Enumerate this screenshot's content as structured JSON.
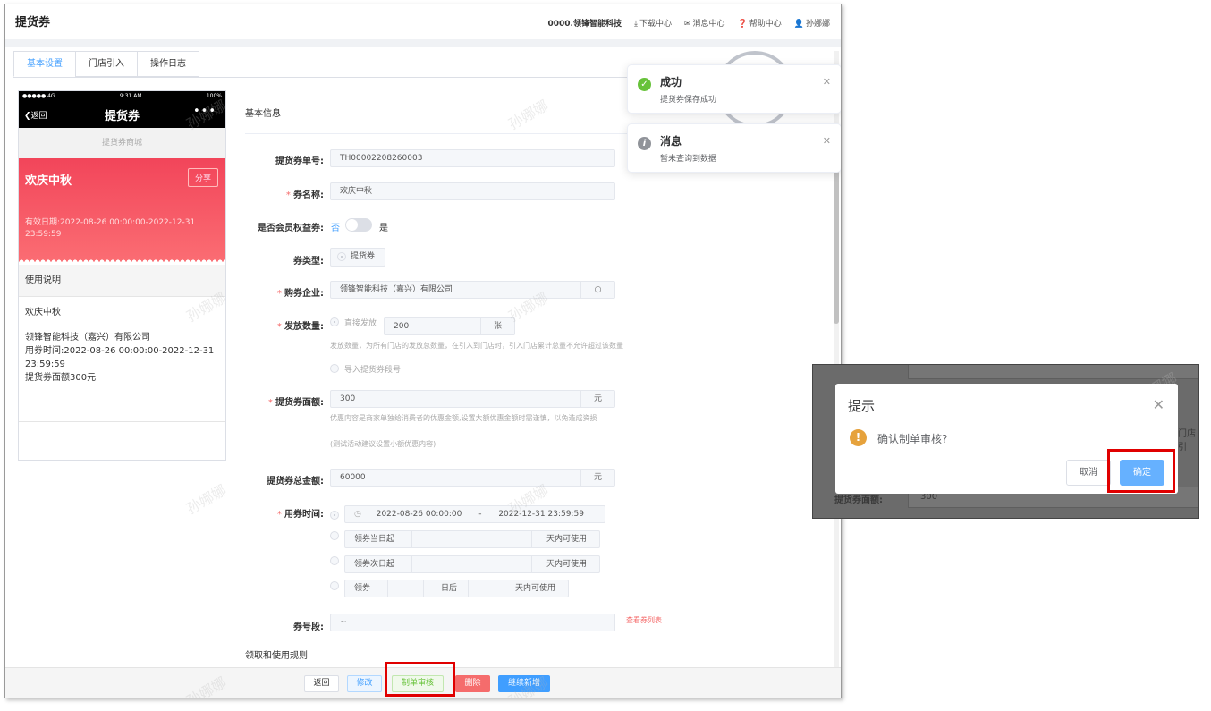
{
  "header": {
    "title": "提货券",
    "company": "0000.领锋智能科技",
    "links": [
      "下载中心",
      "消息中心",
      "帮助中心",
      "孙娜娜"
    ]
  },
  "tabs": [
    "基本设置",
    "门店引入",
    "操作日志"
  ],
  "phone": {
    "status_left": "●●●●● 4G",
    "status_time": "9:31 AM",
    "status_right": "100%",
    "back_label": "返回",
    "title": "提货券",
    "more": "•••",
    "mall_label": "提货券商城",
    "coupon_name": "欢庆中秋",
    "share_label": "分享",
    "validity": "有效日期:2022-08-26 00:00:00-2022-12-31 23:59:59",
    "usage_header": "使用说明",
    "usage_lines": [
      "欢庆中秋",
      "领锋智能科技（嘉兴）有限公司",
      "用券时间:2022-08-26 00:00:00-2022-12-31 23:59:59",
      "提货券面额300元"
    ]
  },
  "form": {
    "section_title": "基本信息",
    "fields": {
      "code_label": "提货券单号:",
      "code_value": "TH00002208260003",
      "name_label": "券名称:",
      "name_value": "欢庆中秋",
      "member_label": "是否会员权益券:",
      "member_off": "否",
      "member_on": "是",
      "type_label": "券类型:",
      "type_value": "提货券",
      "enterprise_label": "购券企业:",
      "enterprise_value": "领锋智能科技（嘉兴）有限公司",
      "qty_label": "发放数量:",
      "qty_option_direct": "直接发放",
      "qty_value": "200",
      "qty_unit": "张",
      "qty_hint": "发放数量，为所有门店的发放总数量，在引入到门店时，引入门店累计总量不允许超过该数量",
      "qty_option_import": "导入提货券段号",
      "face_label": "提货券面额:",
      "face_value": "300",
      "face_unit": "元",
      "face_hint": "优惠内容是商家单独给消费者的优惠金额,设置大额优惠金额时需谨慎，以免造成资损",
      "face_hint2": "(测试活动建议设置小额优惠内容)",
      "total_label": "提货券总金额:",
      "total_value": "60000",
      "total_unit": "元",
      "time_label": "用券时间:",
      "time_start": "2022-08-26 00:00:00",
      "time_sep": "-",
      "time_end": "2022-12-31 23:59:59",
      "rel1_prefix": "领券当日起",
      "rel1_suffix": "天内可使用",
      "rel2_prefix": "领券次日起",
      "rel2_suffix": "天内可使用",
      "rel3_prefix": "领券",
      "rel3_mid": "日后",
      "rel3_suffix": "天内可使用",
      "seg_label": "券号段:",
      "seg_value": "~",
      "seg_link": "查看券列表",
      "rules_title": "领取和使用规则"
    }
  },
  "footer": {
    "return": "返回",
    "edit": "修改",
    "submit_audit": "制单审核",
    "delete": "删除",
    "continue_add": "继续新增"
  },
  "toasts": [
    {
      "title": "成功",
      "message": "提货券保存成功",
      "color": "#67c23a"
    },
    {
      "title": "消息",
      "message": "暂未查询到数据",
      "color": "#909399"
    }
  ],
  "watermark": "孙娜娜",
  "dialog": {
    "title": "提示",
    "message": "确认制单审核?",
    "cancel": "取消",
    "confirm": "确定",
    "bg_label": "提货券面额:",
    "bg_value": "300",
    "bg_store": "门店引"
  },
  "colors": {
    "primary": "#409eff",
    "danger": "#f56c6c",
    "success": "#67c23a",
    "warning": "#e6a23c",
    "highlight": "#e00000"
  }
}
